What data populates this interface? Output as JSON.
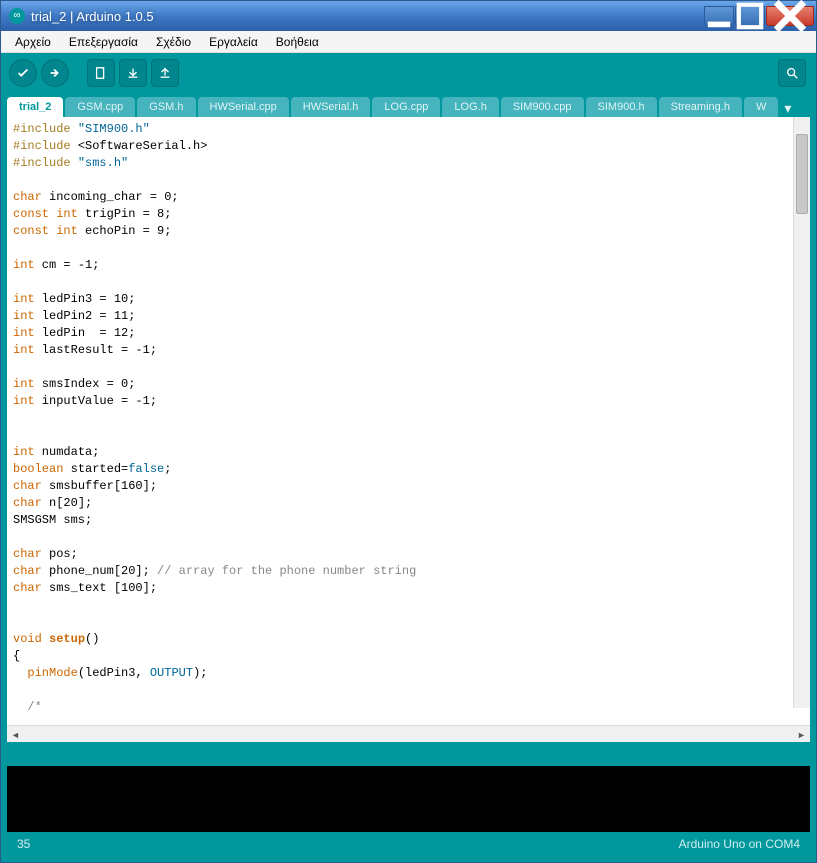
{
  "titlebar": {
    "text": "trial_2 | Arduino 1.0.5"
  },
  "menu": {
    "items": [
      "Αρχείο",
      "Επεξεργασία",
      "Σχέδιο",
      "Εργαλεία",
      "Βοήθεια"
    ]
  },
  "tabs": {
    "items": [
      "trial_2",
      "GSM.cpp",
      "GSM.h",
      "HWSerial.cpp",
      "HWSerial.h",
      "LOG.cpp",
      "LOG.h",
      "SIM900.cpp",
      "SIM900.h",
      "Streaming.h",
      "W"
    ],
    "active": 0
  },
  "code": {
    "lines": [
      [
        {
          "cls": "kw-pre",
          "t": "#include "
        },
        {
          "cls": "kw-inc",
          "t": "\"SIM900.h\""
        }
      ],
      [
        {
          "cls": "kw-pre",
          "t": "#include "
        },
        {
          "cls": "",
          "t": "<SoftwareSerial.h>"
        }
      ],
      [
        {
          "cls": "kw-pre",
          "t": "#include "
        },
        {
          "cls": "kw-inc",
          "t": "\"sms.h\""
        }
      ],
      [],
      [
        {
          "cls": "kw-type",
          "t": "char"
        },
        {
          "cls": "",
          "t": " incoming_char = 0;"
        }
      ],
      [
        {
          "cls": "kw-type",
          "t": "const"
        },
        {
          "cls": "",
          "t": " "
        },
        {
          "cls": "kw-type",
          "t": "int"
        },
        {
          "cls": "",
          "t": " trigPin = 8;"
        }
      ],
      [
        {
          "cls": "kw-type",
          "t": "const"
        },
        {
          "cls": "",
          "t": " "
        },
        {
          "cls": "kw-type",
          "t": "int"
        },
        {
          "cls": "",
          "t": " echoPin = 9;"
        }
      ],
      [],
      [
        {
          "cls": "kw-type",
          "t": "int"
        },
        {
          "cls": "",
          "t": " cm = -1;"
        }
      ],
      [],
      [
        {
          "cls": "kw-type",
          "t": "int"
        },
        {
          "cls": "",
          "t": " ledPin3 = 10;"
        }
      ],
      [
        {
          "cls": "kw-type",
          "t": "int"
        },
        {
          "cls": "",
          "t": " ledPin2 = 11;"
        }
      ],
      [
        {
          "cls": "kw-type",
          "t": "int"
        },
        {
          "cls": "",
          "t": " ledPin  = 12;"
        }
      ],
      [
        {
          "cls": "kw-type",
          "t": "int"
        },
        {
          "cls": "",
          "t": " lastResult = -1;"
        }
      ],
      [],
      [
        {
          "cls": "kw-type",
          "t": "int"
        },
        {
          "cls": "",
          "t": " smsIndex = 0;"
        }
      ],
      [
        {
          "cls": "kw-type",
          "t": "int"
        },
        {
          "cls": "",
          "t": " inputValue = -1;"
        }
      ],
      [],
      [],
      [
        {
          "cls": "kw-type",
          "t": "int"
        },
        {
          "cls": "",
          "t": " numdata;"
        }
      ],
      [
        {
          "cls": "kw-type",
          "t": "boolean"
        },
        {
          "cls": "",
          "t": " started="
        },
        {
          "cls": "kw-const",
          "t": "false"
        },
        {
          "cls": "",
          "t": ";"
        }
      ],
      [
        {
          "cls": "kw-type",
          "t": "char"
        },
        {
          "cls": "",
          "t": " smsbuffer[160];"
        }
      ],
      [
        {
          "cls": "kw-type",
          "t": "char"
        },
        {
          "cls": "",
          "t": " n[20];"
        }
      ],
      [
        {
          "cls": "",
          "t": "SMSGSM sms;"
        }
      ],
      [],
      [
        {
          "cls": "kw-type",
          "t": "char"
        },
        {
          "cls": "",
          "t": " pos;"
        }
      ],
      [
        {
          "cls": "kw-type",
          "t": "char"
        },
        {
          "cls": "",
          "t": " phone_num[20]; "
        },
        {
          "cls": "comment",
          "t": "// array for the phone number string"
        }
      ],
      [
        {
          "cls": "kw-type",
          "t": "char"
        },
        {
          "cls": "",
          "t": " sms_text [100];"
        }
      ],
      [],
      [],
      [
        {
          "cls": "kw-type",
          "t": "void"
        },
        {
          "cls": "",
          "t": " "
        },
        {
          "cls": "kw-setup",
          "t": "setup"
        },
        {
          "cls": "",
          "t": "()"
        }
      ],
      [
        {
          "cls": "",
          "t": "{"
        }
      ],
      [
        {
          "cls": "",
          "t": "  "
        },
        {
          "cls": "kw-fn",
          "t": "pinMode"
        },
        {
          "cls": "",
          "t": "(ledPin3, "
        },
        {
          "cls": "kw-const",
          "t": "OUTPUT"
        },
        {
          "cls": "",
          "t": ");"
        }
      ],
      [],
      [
        {
          "cls": "",
          "t": "  "
        },
        {
          "cls": "comment",
          "t": "/*"
        }
      ]
    ]
  },
  "status": {
    "line": "35",
    "board": "Arduino Uno on COM4"
  }
}
